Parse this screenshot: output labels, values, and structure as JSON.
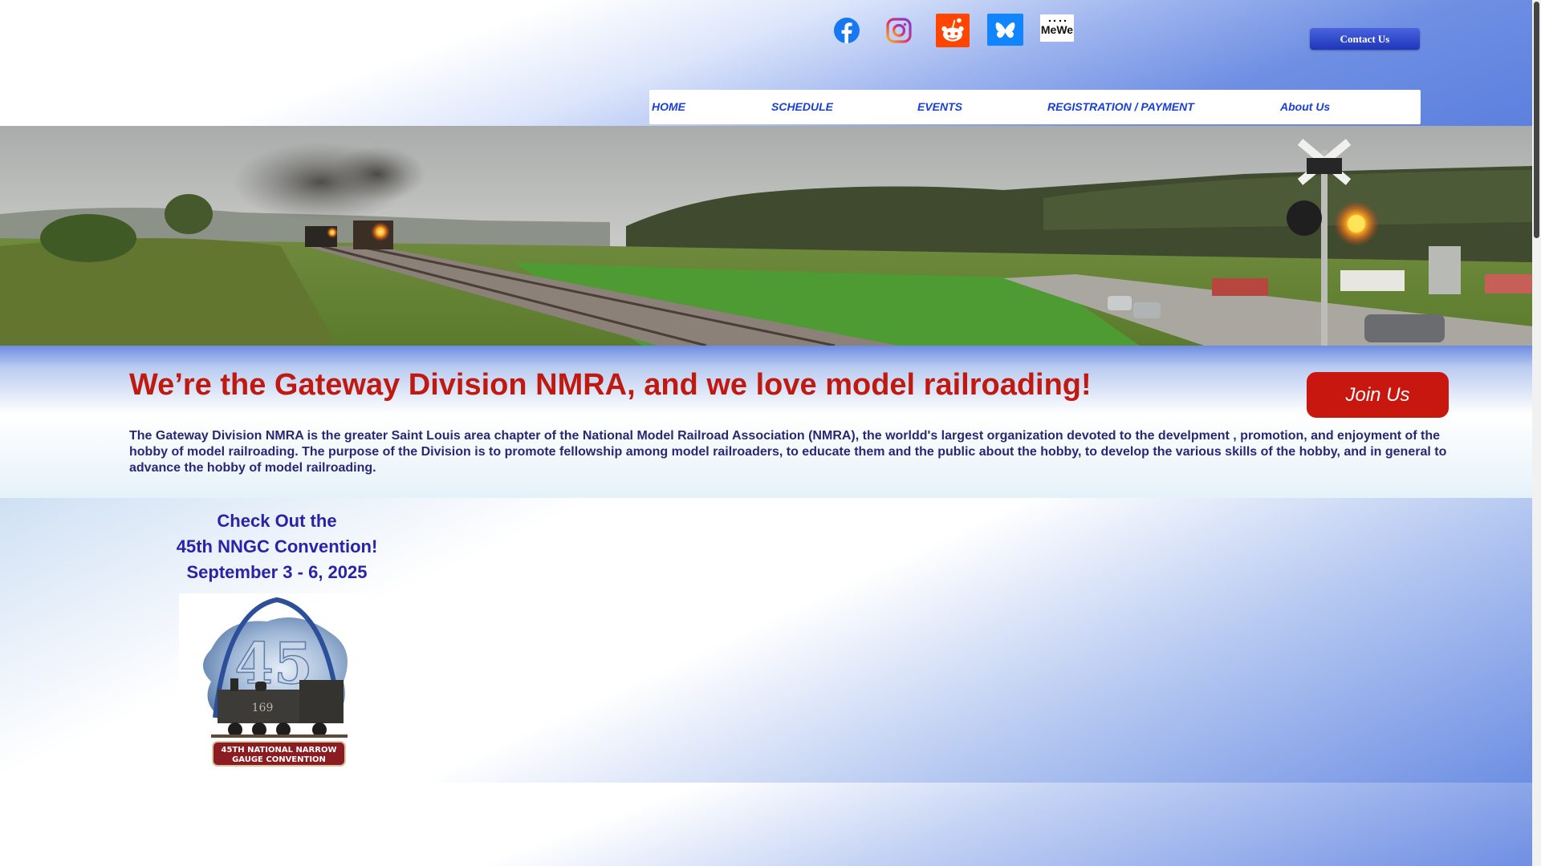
{
  "header": {
    "social": {
      "facebook": "facebook-icon",
      "instagram": "instagram-icon",
      "reddit": "reddit-icon",
      "bluesky": "bluesky-icon",
      "mewe_label": "MeWe"
    },
    "contact_label": "Contact Us"
  },
  "nav": {
    "items": [
      {
        "label": "HOME"
      },
      {
        "label": "SCHEDULE"
      },
      {
        "label": "EVENTS"
      },
      {
        "label": "REGISTRATION / PAYMENT"
      },
      {
        "label": "About Us"
      }
    ]
  },
  "intro": {
    "title": "We’re the Gateway Division NMRA, and we love model railroading!",
    "join_label": "Join Us",
    "body": "The Gateway Division NMRA is the greater Saint Louis area chapter of the National Model Railroad Association (NMRA), the worldd's largest organization devoted to the develpment , promotion, and enjoyment of the hobby of model railroading.  The purpose of the Division is to promote fellowship among model railroaders, to educate them and the public about the hobby, to develop the various skills of the hobby, and in general to advance the hobby of model railroading."
  },
  "convention": {
    "line1": "Check Out the",
    "line2": "45th NNGC Convention!",
    "line3": "September 3 - 6, 2025",
    "logo_number": "45",
    "logo_loco_number": "169",
    "logo_banner_line1": "45TH NATIONAL NARROW",
    "logo_banner_line2": "GAUGE CONVENTION"
  },
  "colors": {
    "accent_red": "#c8170f",
    "nav_blue": "#1a3fd4",
    "contact_blue": "#1e36b8"
  }
}
